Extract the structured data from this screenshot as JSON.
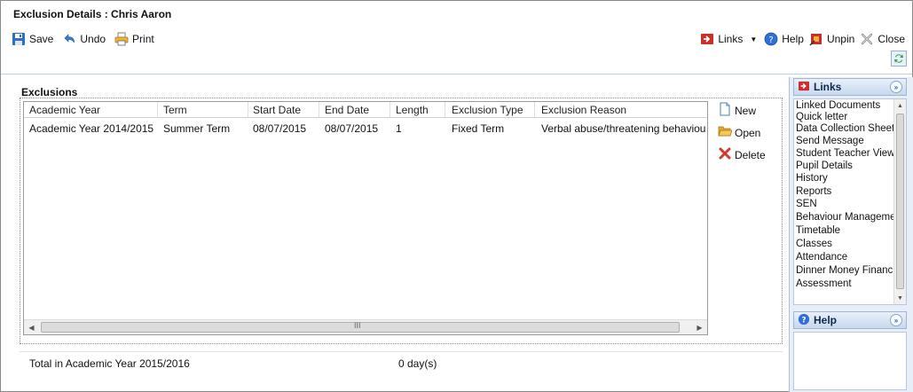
{
  "window": {
    "title": "Exclusion Details : Chris Aaron"
  },
  "toolbar": {
    "save_label": "Save",
    "undo_label": "Undo",
    "print_label": "Print",
    "links_label": "Links",
    "help_label": "Help",
    "unpin_label": "Unpin",
    "close_label": "Close"
  },
  "exclusions": {
    "group_title": "Exclusions",
    "columns": [
      "Academic Year",
      "Term",
      "Start Date",
      "End Date",
      "Length",
      "Exclusion Type",
      "Exclusion Reason"
    ],
    "rows": [
      [
        "Academic Year 2014/2015",
        "Summer Term",
        "08/07/2015",
        "08/07/2015",
        "1",
        "Fixed Term",
        "Verbal abuse/threatening behaviour a.."
      ]
    ],
    "scroll_grip": "III",
    "actions": {
      "new_label": "New",
      "open_label": "Open",
      "delete_label": "Delete"
    },
    "total_label": "Total in Academic Year 2015/2016",
    "total_value": "0 day(s)"
  },
  "links_panel": {
    "title": "Links",
    "items": [
      "Linked Documents",
      "Quick letter",
      "Data Collection Sheet",
      "Send Message",
      "Student Teacher View",
      "Pupil Details",
      "History",
      "Reports",
      "SEN",
      "Behaviour Management",
      "Timetable",
      "Classes",
      "Attendance",
      "Dinner Money Financial",
      "Assessment"
    ]
  },
  "help_panel": {
    "title": "Help"
  },
  "colors": {
    "accent": "#c7d8ee",
    "panel_bg": "#e7eef8",
    "delete_red": "#d03a2a",
    "save_blue": "#2f6fbf"
  }
}
